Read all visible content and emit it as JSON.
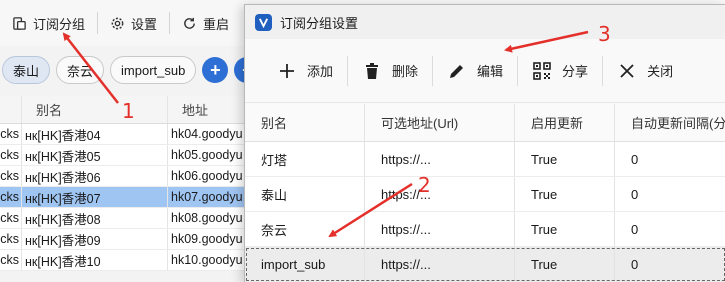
{
  "main": {
    "toolbar": [
      {
        "label": "订阅分组",
        "icon": "subscription-group-icon"
      },
      {
        "label": "设置",
        "icon": "gear-icon"
      },
      {
        "label": "重启",
        "icon": "restart-icon"
      }
    ],
    "filters": [
      {
        "label": "泰山",
        "active": true
      },
      {
        "label": "奈云",
        "active": false
      },
      {
        "label": "import_sub",
        "active": false
      }
    ],
    "add_label": "+",
    "table": {
      "headers": [
        "别名",
        "地址"
      ],
      "rows": [
        {
          "type": "cks",
          "alias": "нк[HK]香港04",
          "address": "hk04.goodyu",
          "selected": false
        },
        {
          "type": "cks",
          "alias": "нк[HK]香港05",
          "address": "hk05.goodyu",
          "selected": false
        },
        {
          "type": "cks",
          "alias": "нк[HK]香港06",
          "address": "hk06.goodyu",
          "selected": false
        },
        {
          "type": "cks",
          "alias": "нк[HK]香港07",
          "address": "hk07.goodyu",
          "selected": true
        },
        {
          "type": "cks",
          "alias": "нк[HK]香港08",
          "address": "hk08.goodyu",
          "selected": false
        },
        {
          "type": "cks",
          "alias": "нк[HK]香港09",
          "address": "hk09.goodyu",
          "selected": false
        },
        {
          "type": "cks",
          "alias": "нк[HK]香港10",
          "address": "hk10.goodyu",
          "selected": false
        }
      ]
    }
  },
  "dialog": {
    "title": "订阅分组设置",
    "toolbar": {
      "add": "添加",
      "delete": "删除",
      "edit": "编辑",
      "share": "分享",
      "close": "关闭"
    },
    "table": {
      "headers": [
        "别名",
        "可选地址(Url)",
        "启用更新",
        "自动更新间隔(分钟)"
      ],
      "rows": [
        {
          "alias": "灯塔",
          "url": "https://...",
          "enabled": "True",
          "interval": "0",
          "selected": false
        },
        {
          "alias": "泰山",
          "url": "https://...",
          "enabled": "True",
          "interval": "0",
          "selected": false
        },
        {
          "alias": "奈云",
          "url": "https://...",
          "enabled": "True",
          "interval": "0",
          "selected": false
        },
        {
          "alias": "import_sub",
          "url": "https://...",
          "enabled": "True",
          "interval": "0",
          "selected": true
        }
      ]
    }
  },
  "annotations": {
    "labels": [
      "1",
      "2",
      "3"
    ],
    "color": "#e4302b"
  }
}
